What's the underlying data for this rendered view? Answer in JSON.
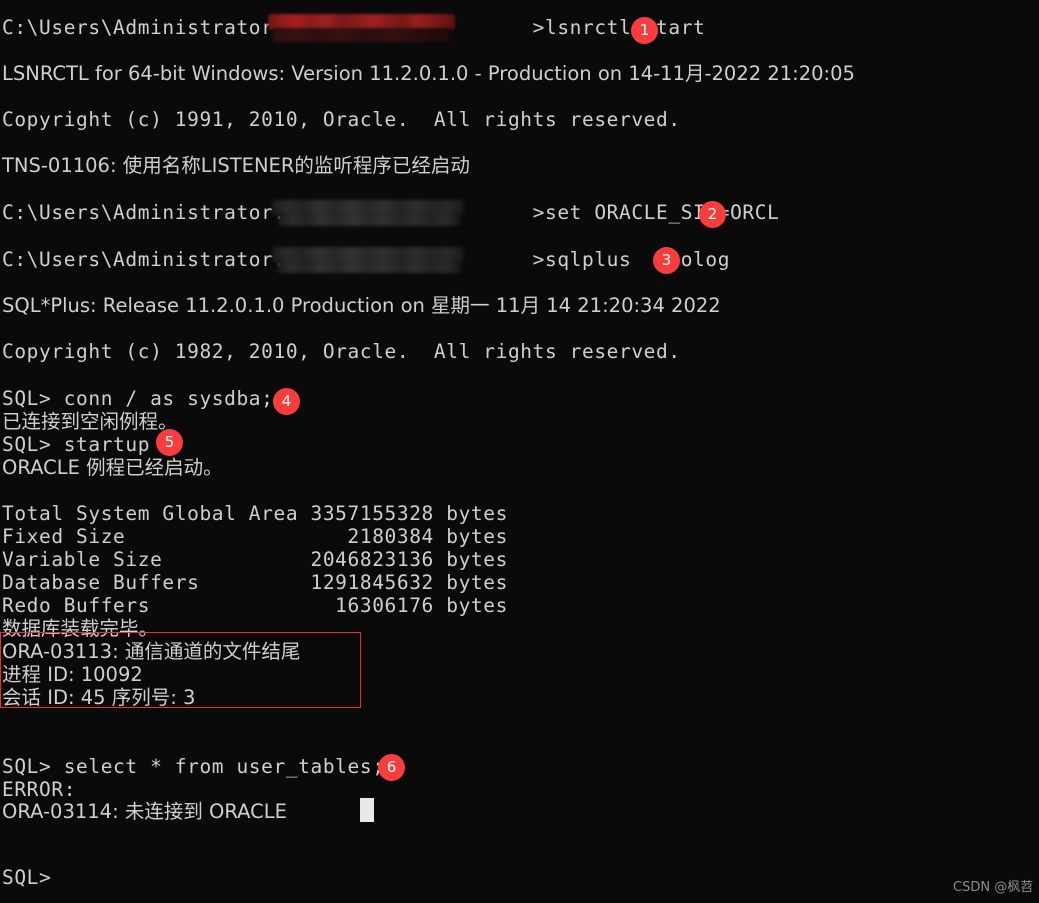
{
  "terminal": {
    "background_color": "#0a0a0a",
    "text_color": "#cfcfcf",
    "accent_color": "#f93d3d",
    "lines": [
      {
        "text": "C:\\Users\\Administrator.",
        "suffix": ">lsnrctl start"
      },
      {
        "text": "LSNRCTL for 64-bit Windows: Version 11.2.0.1.0 - Production on 14-11月-2022 21:20:05"
      },
      {
        "text": "Copyright (c) 1991, 2010, Oracle.  All rights reserved."
      },
      {
        "text": "TNS-01106: 使用名称LISTENER的监听程序已经启动"
      },
      {
        "text": "C:\\Users\\Administrator.",
        "suffix": ">set ORACLE_SID=ORCL"
      },
      {
        "text": "C:\\Users\\Administrator.",
        "suffix": ">sqlplus  /nolog"
      },
      {
        "text": "SQL*Plus: Release 11.2.0.1.0 Production on 星期一 11月 14 21:20:34 2022"
      },
      {
        "text": "Copyright (c) 1982, 2010, Oracle.  All rights reserved."
      },
      {
        "text": "SQL> conn / as sysdba;"
      },
      {
        "text": "已连接到空闲例程。"
      },
      {
        "text": "SQL> startup"
      },
      {
        "text": "ORACLE 例程已经启动。"
      },
      {
        "text": "Total System Global Area 3357155328 bytes"
      },
      {
        "text": "Fixed Size                  2180384 bytes"
      },
      {
        "text": "Variable Size            2046823136 bytes"
      },
      {
        "text": "Database Buffers         1291845632 bytes"
      },
      {
        "text": "Redo Buffers               16306176 bytes"
      },
      {
        "text": "数据库装载完毕。"
      },
      {
        "text": "ORA-03113: 通信通道的文件结尾"
      },
      {
        "text": "进程 ID: 10092"
      },
      {
        "text": "会话 ID: 45 序列号: 3"
      },
      {
        "text": "SQL> select * from user_tables;"
      },
      {
        "text": "ERROR:"
      },
      {
        "text": "ORA-03114: 未连接到 ORACLE"
      },
      {
        "text": "SQL>"
      }
    ]
  },
  "lines_text": {
    "l0_prefix": "C:\\Users\\Administrator.",
    "l0_suffix": ">lsnrctl start",
    "l1": "LSNRCTL for 64-bit Windows: Version 11.2.0.1.0 - Production on 14-11月-2022 21:20:05",
    "l2": "Copyright (c) 1991, 2010, Oracle.  All rights reserved.",
    "l3": "TNS-01106: 使用名称LISTENER的监听程序已经启动",
    "l4_prefix": "C:\\Users\\Administrator.",
    "l4_suffix": ">set ORACLE_SID=ORCL",
    "l5_prefix": "C:\\Users\\Administrator.",
    "l5_suffix": ">sqlplus  /nolog",
    "l6": "SQL*Plus: Release 11.2.0.1.0 Production on 星期一 11月 14 21:20:34 2022",
    "l7": "Copyright (c) 1982, 2010, Oracle.  All rights reserved.",
    "l8": "SQL> conn / as sysdba;",
    "l9": "已连接到空闲例程。",
    "l10": "SQL> startup",
    "l11": "ORACLE 例程已经启动。",
    "l12": "Total System Global Area 3357155328 bytes",
    "l13": "Fixed Size                  2180384 bytes",
    "l14": "Variable Size            2046823136 bytes",
    "l15": "Database Buffers         1291845632 bytes",
    "l16": "Redo Buffers               16306176 bytes",
    "l17": "数据库装载完毕。",
    "l18": "ORA-03113: 通信通道的文件结尾",
    "l19": "进程 ID: 10092",
    "l20": "会话 ID: 45 序列号: 3",
    "l21": "SQL> select * from user_tables;",
    "l22": "ERROR:",
    "l23": "ORA-03114: 未连接到 ORACLE",
    "l24": "SQL>"
  },
  "sga_table": {
    "rows": [
      {
        "label": "Total System Global Area",
        "value": "3357155328",
        "unit": "bytes"
      },
      {
        "label": "Fixed Size",
        "value": "2180384",
        "unit": "bytes"
      },
      {
        "label": "Variable Size",
        "value": "2046823136",
        "unit": "bytes"
      },
      {
        "label": "Database Buffers",
        "value": "1291845632",
        "unit": "bytes"
      },
      {
        "label": "Redo Buffers",
        "value": "16306176",
        "unit": "bytes"
      }
    ]
  },
  "annotations": {
    "badges": [
      {
        "number": "1",
        "for": "lsnrctl start"
      },
      {
        "number": "2",
        "for": "set ORACLE_SID=ORCL"
      },
      {
        "number": "3",
        "for": "sqlplus /nolog"
      },
      {
        "number": "4",
        "for": "conn / as sysdba;"
      },
      {
        "number": "5",
        "for": "startup"
      },
      {
        "number": "6",
        "for": "select * from user_tables;"
      }
    ],
    "highlight_box_label": "ORA-03113 error block"
  },
  "watermark": {
    "text": "CSDN @枫苕"
  }
}
